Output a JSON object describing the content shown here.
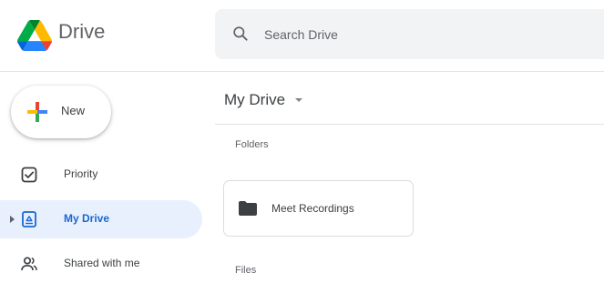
{
  "app": {
    "brand": "Drive"
  },
  "search": {
    "placeholder": "Search Drive",
    "value": ""
  },
  "sidebar": {
    "new_label": "New",
    "items": [
      {
        "label": "Priority",
        "icon": "priority-checkbox-icon",
        "active": false
      },
      {
        "label": "My Drive",
        "icon": "my-drive-icon",
        "active": true
      },
      {
        "label": "Shared with me",
        "icon": "shared-people-icon",
        "active": false
      }
    ]
  },
  "main": {
    "title": "My Drive",
    "folders_label": "Folders",
    "files_label": "Files",
    "folders": [
      {
        "name": "Meet Recordings"
      }
    ]
  },
  "colors": {
    "accent": "#1967d2",
    "active_bg": "#e8f0fe",
    "search_bg": "#f1f3f4",
    "google_blue": "#4285f4",
    "google_red": "#ea4335",
    "google_yellow": "#fbbc04",
    "google_green": "#34a853"
  }
}
